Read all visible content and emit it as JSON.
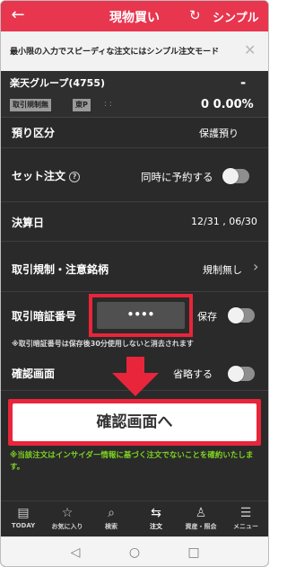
{
  "header": {
    "back_icon": "←",
    "title": "現物買い",
    "refresh_icon": "↻",
    "mode_label": "シンプル"
  },
  "notice": {
    "text": "最小限の入力でスピーディな注文にはシンプル注文モード",
    "close_icon": "✕"
  },
  "stock": {
    "name": "楽天グループ(4755)",
    "price": "-",
    "tag_restriction": "取引規制無",
    "tag_market": "東P",
    "dots": ": :",
    "change": "0 0.00%"
  },
  "rows": {
    "deposit": {
      "label": "預り区分",
      "value": "保護預り"
    },
    "set_order": {
      "label": "セット注文",
      "help_icon": "?",
      "value": "同時に予約する",
      "toggle_on": false
    },
    "settlement": {
      "label": "決算日",
      "value": "12/31 , 06/30"
    },
    "restriction": {
      "label": "取引規制・注意銘柄",
      "value": "規制無し",
      "chevron": "›"
    },
    "pin": {
      "label": "取引暗証番号",
      "masked": "••••",
      "save_label": "保存",
      "toggle_on": false
    },
    "confirm_screen": {
      "label": "確認画面",
      "value": "省略する",
      "toggle_on": false
    }
  },
  "pin_note": "※取引暗証番号は保存後30分使用しないと消去されます",
  "confirm_button": "確認画面へ",
  "disclaimer": "※当該注文はインサイダー情報に基づく注文でないことを確約いたします。",
  "tabs": [
    {
      "icon": "▤",
      "label": "TODAY"
    },
    {
      "icon": "☆",
      "label": "お気に入り"
    },
    {
      "icon": "⌕",
      "label": "検索"
    },
    {
      "icon": "⇆",
      "label": "注文"
    },
    {
      "icon": "♙",
      "label": "資産・照会"
    },
    {
      "icon": "☰",
      "label": "メニュー"
    }
  ],
  "android_nav": {
    "back": "◁",
    "home": "○",
    "recents": "□"
  },
  "colors": {
    "accent": "#e8364f",
    "highlight": "#e8253a",
    "disclaimer": "#7ed321"
  }
}
